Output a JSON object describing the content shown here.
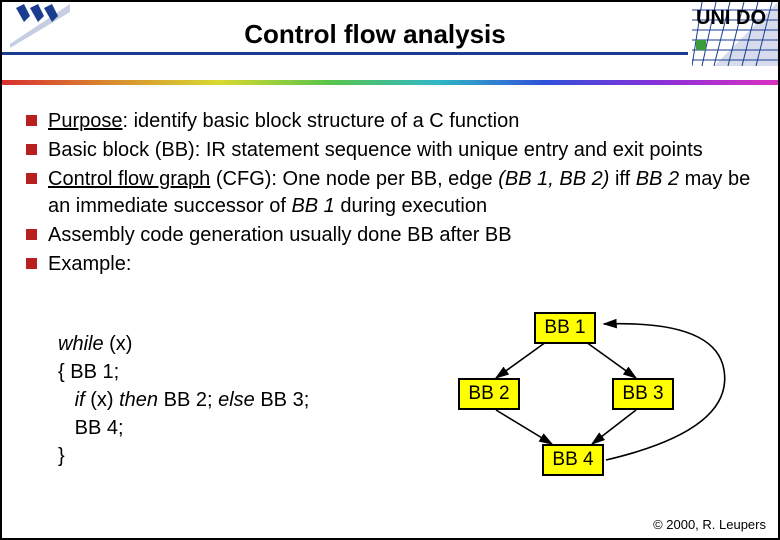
{
  "header": {
    "title": "Control flow analysis",
    "logo_right_text": "UNI DO"
  },
  "bullets": [
    {
      "pre_u": "",
      "u": "Purpose",
      "post_u": ": identify basic block structure of a C function"
    },
    {
      "pre_u": "Basic block (BB): IR statement sequence with unique entry and exit points",
      "u": "",
      "post_u": ""
    },
    {
      "pre_u": "",
      "u": "Control flow graph",
      "post_u_plain": " (CFG): One node per BB, edge ",
      "post_u_i": "(BB 1, BB 2)",
      "post_u_plain2": " iff ",
      "post_u_i2": "BB 2",
      "post_u_plain3": " may be an immediate successor of ",
      "post_u_i3": "BB 1",
      "post_u_plain4": " during execution"
    },
    {
      "pre_u": "Assembly code generation usually done BB after BB",
      "u": "",
      "post_u": ""
    },
    {
      "pre_u": "Example:",
      "u": "",
      "post_u": ""
    }
  ],
  "code": {
    "l1_i": "while",
    "l1_r": " (x)",
    "l2": "{ BB 1;",
    "l3_pad": "   ",
    "l3_i1": "if",
    "l3_m1": " (x) ",
    "l3_i2": "then",
    "l3_m2": " BB 2; ",
    "l3_i3": "else",
    "l3_m3": " BB 3;",
    "l4_pad": "   ",
    "l4": "BB 4;",
    "l5": "}"
  },
  "cfg": {
    "bb1": "BB 1",
    "bb2": "BB 2",
    "bb3": "BB 3",
    "bb4": "BB 4"
  },
  "footer": "© 2000, R. Leupers"
}
